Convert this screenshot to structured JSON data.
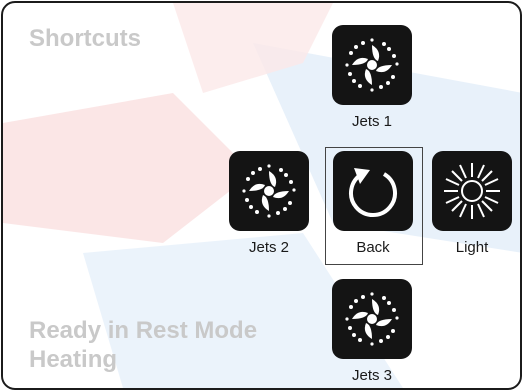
{
  "header": {
    "title": "Shortcuts"
  },
  "status": {
    "line1": "Ready in Rest Mode",
    "line2": "Heating"
  },
  "buttons": {
    "jets1": {
      "label": "Jets 1",
      "icon": "jets-icon"
    },
    "jets2": {
      "label": "Jets 2",
      "icon": "jets-icon"
    },
    "back": {
      "label": "Back",
      "icon": "back-arrow-icon"
    },
    "light": {
      "label": "Light",
      "icon": "light-icon"
    },
    "jets3": {
      "label": "Jets 3",
      "icon": "jets-icon"
    }
  },
  "colors": {
    "tile": "#141414",
    "muted_text": "#c9c9c9",
    "watermark_red": "#f3c4c4",
    "watermark_blue": "#cfe3f5"
  }
}
